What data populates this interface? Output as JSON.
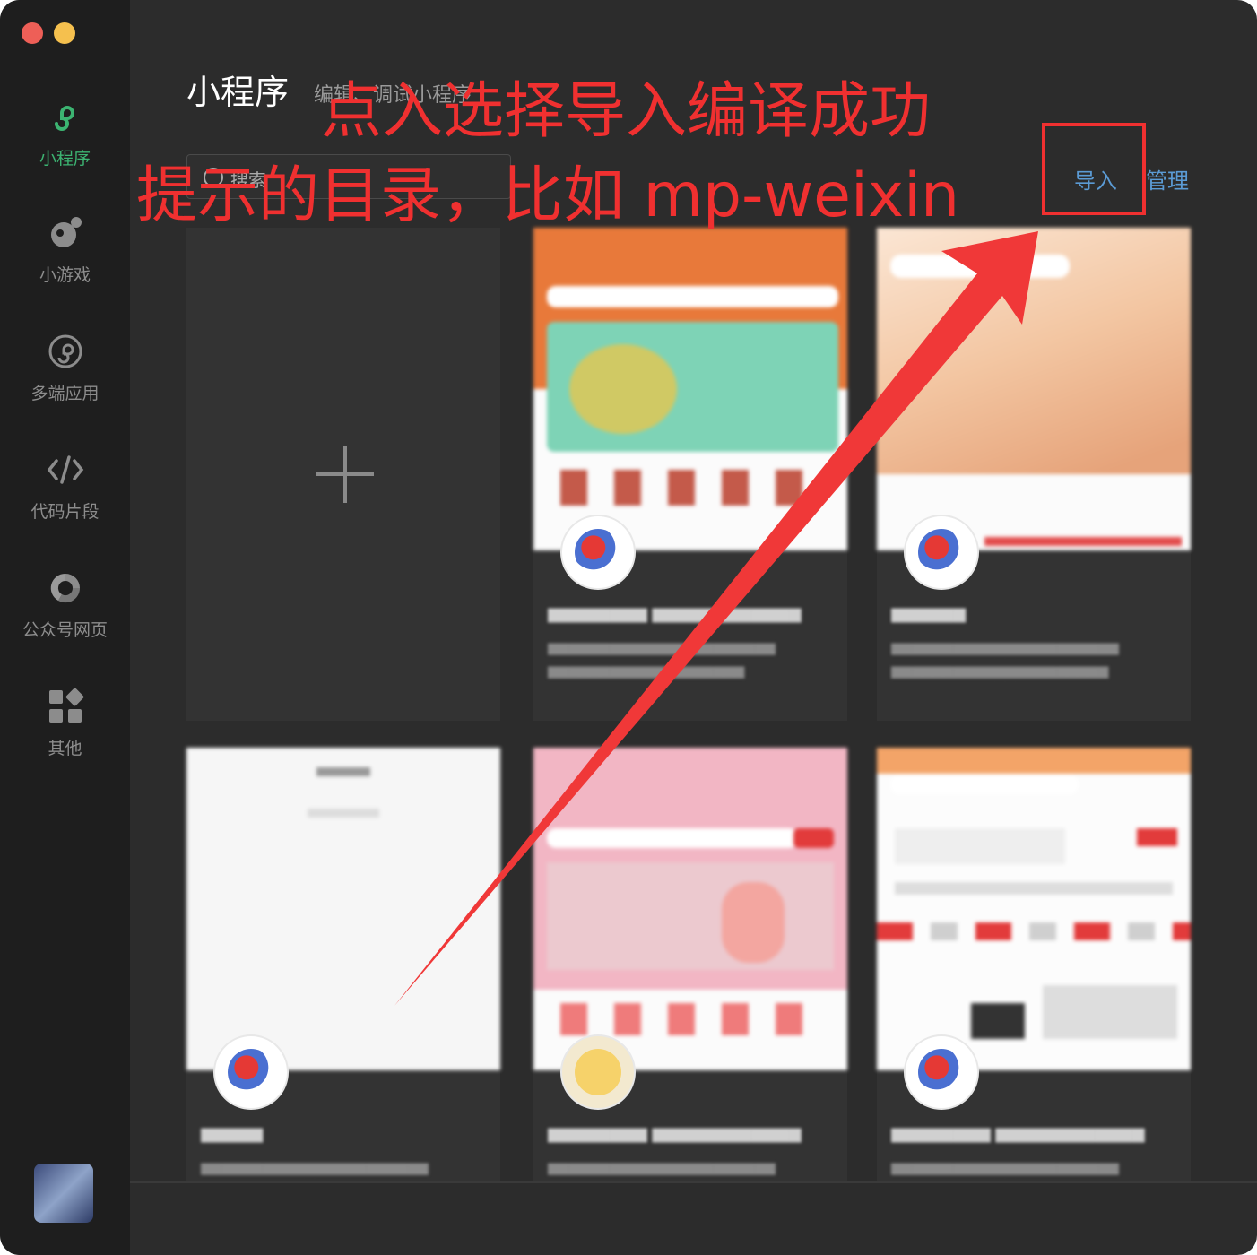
{
  "sidebar": {
    "items": [
      {
        "label": "小程序",
        "icon": "mini-program-icon"
      },
      {
        "label": "小游戏",
        "icon": "game-icon"
      },
      {
        "label": "多端应用",
        "icon": "multi-platform-icon"
      },
      {
        "label": "代码片段",
        "icon": "code-icon"
      },
      {
        "label": "公众号网页",
        "icon": "web-icon"
      },
      {
        "label": "其他",
        "icon": "other-apps-icon"
      }
    ]
  },
  "header": {
    "title": "小程序",
    "subtitle": "编辑、调试小程序",
    "search_placeholder": "搜索",
    "import_label": "导入",
    "manage_label": "管理"
  },
  "annotation": {
    "line1": "点入选择导入编译成功",
    "line2": "提示的目录，比如 mp-weixin"
  },
  "colors": {
    "accent_green": "#3cb371",
    "link_blue": "#5b9bd5",
    "annotation_red": "#f03030"
  }
}
